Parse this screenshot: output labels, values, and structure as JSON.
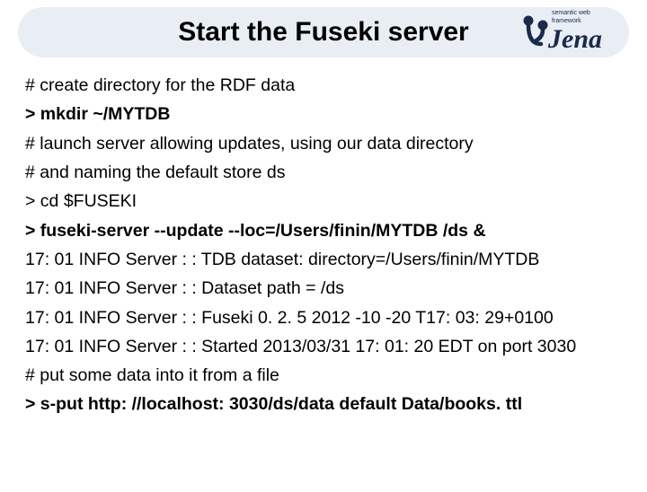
{
  "title": "Start the Fuseki server",
  "logo": {
    "brand": "Jena",
    "tagline1": "semantic web",
    "tagline2": "framework"
  },
  "lines": {
    "c1": "# create directory for the RDF data",
    "c2": "> mkdir ~/MYTDB",
    "c3": "# launch server allowing updates, using our data directory",
    "c4": "#   and naming the default store ds",
    "c5": "> cd $FUSEKI",
    "c6": "> fuseki-server --update --loc=/Users/finin/MYTDB /ds &",
    "c7": "17: 01 INFO Server : : TDB dataset: directory=/Users/finin/MYTDB",
    "c8": "17: 01 INFO Server : : Dataset path = /ds",
    "c9": "17: 01 INFO Server : : Fuseki 0. 2. 5 2012 -10 -20 T17: 03: 29+0100",
    "c10": "17: 01 INFO Server : : Started 2013/03/31 17: 01: 20 EDT on port 3030",
    "c11": "# put some data into it from a file",
    "c12": "> s-put http: //localhost: 3030/ds/data default Data/books. ttl"
  }
}
